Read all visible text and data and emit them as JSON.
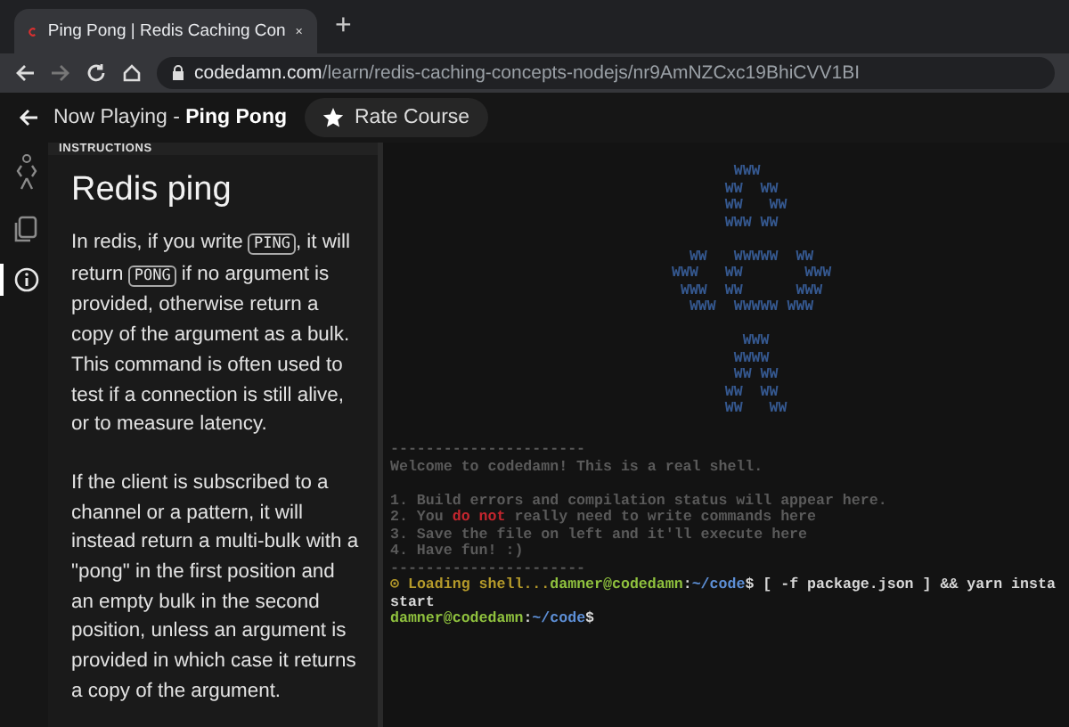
{
  "browser": {
    "tab_title": "Ping Pong | Redis Caching Con",
    "new_tab": "+",
    "url_host": "codedamn.com",
    "url_path": "/learn/redis-caching-concepts-nodejs/nr9AmNZCxc19BhiCVV1BI"
  },
  "header": {
    "now_playing_label": "Now Playing - ",
    "now_playing_title": "Ping Pong",
    "rate_button": "Rate Course"
  },
  "rail": [
    {
      "kind": "mascot",
      "selected": false
    },
    {
      "kind": "files",
      "selected": false
    },
    {
      "kind": "info",
      "selected": true
    }
  ],
  "instructions": {
    "section_label": "INSTRUCTIONS",
    "title": "Redis ping",
    "paragraphs": [
      [
        {
          "text": "In redis, if you write "
        },
        {
          "text": "PING",
          "kind": "code"
        },
        {
          "text": ", it will return "
        },
        {
          "text": "PONG",
          "kind": "code"
        },
        {
          "text": " if no argument is provided, otherwise return a copy of the argument as a bulk. This command is often used to test if a connection is still alive, or to measure latency."
        }
      ],
      [
        {
          "text": "If the client is subscribed to a channel or a pattern, it will instead return a multi-bulk with a \"pong\" in the first position and an empty bulk in the second position, unless an argument is provided in which case it returns a copy of the argument."
        }
      ]
    ]
  },
  "terminal": {
    "ascii_art": [
      [
        "       WWW",
        "      WW  WW",
        "      WW   WW",
        "      WWW WW"
      ],
      [
        "  WW   WWWWW  WW",
        "WWW   WW       WWW",
        " WWW  WW      WWW",
        "  WWW  WWWWW WWW"
      ],
      [
        "        WWW",
        "       WWWW",
        "       WW WW",
        "      WW  WW",
        "      WW   WW"
      ]
    ],
    "blocks": [
      [
        [
          {
            "text": "----------------------",
            "color": "#5a5a5a"
          }
        ],
        [
          {
            "text": "Welcome to codedamn! This is a real shell.",
            "color": "#5a5a5a"
          }
        ]
      ],
      [
        [
          {
            "text": "1. Build errors and compilation status will appear here.",
            "color": "#5a5a5a"
          }
        ],
        [
          {
            "text": "2. You ",
            "color": "#5a5a5a"
          },
          {
            "text": "do not",
            "color": "#c4262e"
          },
          {
            "text": " really need to write commands here",
            "color": "#5a5a5a"
          }
        ],
        [
          {
            "text": "3. Save the file on left and it'll execute here",
            "color": "#5a5a5a"
          }
        ],
        [
          {
            "text": "4. Have fun! :)",
            "color": "#5a5a5a"
          }
        ],
        [
          {
            "text": "----------------------",
            "color": "#5a5a5a"
          }
        ],
        [
          {
            "text": "⊙ Loading shell...",
            "color": "#b59a2a"
          },
          {
            "text": "damner@codedamn",
            "color": "#8fc13e"
          },
          {
            "text": ":",
            "color": "#d8d8d8"
          },
          {
            "text": "~/code",
            "color": "#5d8fd6"
          },
          {
            "text": "$ [ -f package.json ] && yarn insta",
            "color": "#d8d8d8"
          }
        ],
        [
          {
            "text": "start",
            "color": "#d8d8d8"
          }
        ],
        [
          {
            "text": "damner@codedamn",
            "color": "#8fc13e"
          },
          {
            "text": ":",
            "color": "#d8d8d8"
          },
          {
            "text": "~/code",
            "color": "#5d8fd6"
          },
          {
            "text": "$",
            "color": "#d8d8d8"
          }
        ]
      ]
    ]
  }
}
